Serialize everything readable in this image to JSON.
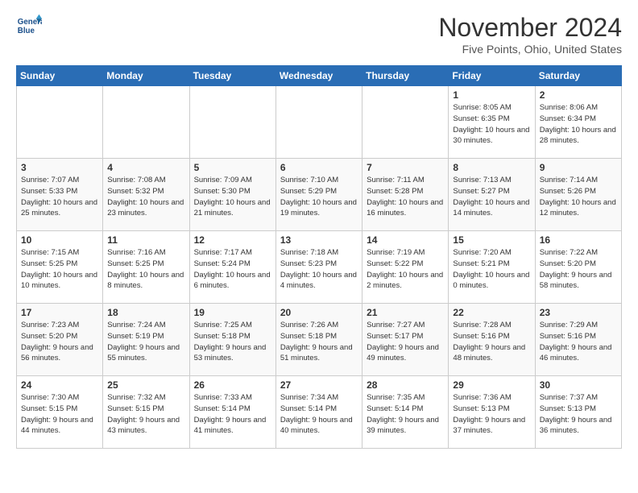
{
  "header": {
    "logo_line1": "General",
    "logo_line2": "Blue",
    "month_title": "November 2024",
    "location": "Five Points, Ohio, United States"
  },
  "weekdays": [
    "Sunday",
    "Monday",
    "Tuesday",
    "Wednesday",
    "Thursday",
    "Friday",
    "Saturday"
  ],
  "weeks": [
    [
      {
        "day": "",
        "info": ""
      },
      {
        "day": "",
        "info": ""
      },
      {
        "day": "",
        "info": ""
      },
      {
        "day": "",
        "info": ""
      },
      {
        "day": "",
        "info": ""
      },
      {
        "day": "1",
        "info": "Sunrise: 8:05 AM\nSunset: 6:35 PM\nDaylight: 10 hours\nand 30 minutes."
      },
      {
        "day": "2",
        "info": "Sunrise: 8:06 AM\nSunset: 6:34 PM\nDaylight: 10 hours\nand 28 minutes."
      }
    ],
    [
      {
        "day": "3",
        "info": "Sunrise: 7:07 AM\nSunset: 5:33 PM\nDaylight: 10 hours\nand 25 minutes."
      },
      {
        "day": "4",
        "info": "Sunrise: 7:08 AM\nSunset: 5:32 PM\nDaylight: 10 hours\nand 23 minutes."
      },
      {
        "day": "5",
        "info": "Sunrise: 7:09 AM\nSunset: 5:30 PM\nDaylight: 10 hours\nand 21 minutes."
      },
      {
        "day": "6",
        "info": "Sunrise: 7:10 AM\nSunset: 5:29 PM\nDaylight: 10 hours\nand 19 minutes."
      },
      {
        "day": "7",
        "info": "Sunrise: 7:11 AM\nSunset: 5:28 PM\nDaylight: 10 hours\nand 16 minutes."
      },
      {
        "day": "8",
        "info": "Sunrise: 7:13 AM\nSunset: 5:27 PM\nDaylight: 10 hours\nand 14 minutes."
      },
      {
        "day": "9",
        "info": "Sunrise: 7:14 AM\nSunset: 5:26 PM\nDaylight: 10 hours\nand 12 minutes."
      }
    ],
    [
      {
        "day": "10",
        "info": "Sunrise: 7:15 AM\nSunset: 5:25 PM\nDaylight: 10 hours\nand 10 minutes."
      },
      {
        "day": "11",
        "info": "Sunrise: 7:16 AM\nSunset: 5:25 PM\nDaylight: 10 hours\nand 8 minutes."
      },
      {
        "day": "12",
        "info": "Sunrise: 7:17 AM\nSunset: 5:24 PM\nDaylight: 10 hours\nand 6 minutes."
      },
      {
        "day": "13",
        "info": "Sunrise: 7:18 AM\nSunset: 5:23 PM\nDaylight: 10 hours\nand 4 minutes."
      },
      {
        "day": "14",
        "info": "Sunrise: 7:19 AM\nSunset: 5:22 PM\nDaylight: 10 hours\nand 2 minutes."
      },
      {
        "day": "15",
        "info": "Sunrise: 7:20 AM\nSunset: 5:21 PM\nDaylight: 10 hours\nand 0 minutes."
      },
      {
        "day": "16",
        "info": "Sunrise: 7:22 AM\nSunset: 5:20 PM\nDaylight: 9 hours\nand 58 minutes."
      }
    ],
    [
      {
        "day": "17",
        "info": "Sunrise: 7:23 AM\nSunset: 5:20 PM\nDaylight: 9 hours\nand 56 minutes."
      },
      {
        "day": "18",
        "info": "Sunrise: 7:24 AM\nSunset: 5:19 PM\nDaylight: 9 hours\nand 55 minutes."
      },
      {
        "day": "19",
        "info": "Sunrise: 7:25 AM\nSunset: 5:18 PM\nDaylight: 9 hours\nand 53 minutes."
      },
      {
        "day": "20",
        "info": "Sunrise: 7:26 AM\nSunset: 5:18 PM\nDaylight: 9 hours\nand 51 minutes."
      },
      {
        "day": "21",
        "info": "Sunrise: 7:27 AM\nSunset: 5:17 PM\nDaylight: 9 hours\nand 49 minutes."
      },
      {
        "day": "22",
        "info": "Sunrise: 7:28 AM\nSunset: 5:16 PM\nDaylight: 9 hours\nand 48 minutes."
      },
      {
        "day": "23",
        "info": "Sunrise: 7:29 AM\nSunset: 5:16 PM\nDaylight: 9 hours\nand 46 minutes."
      }
    ],
    [
      {
        "day": "24",
        "info": "Sunrise: 7:30 AM\nSunset: 5:15 PM\nDaylight: 9 hours\nand 44 minutes."
      },
      {
        "day": "25",
        "info": "Sunrise: 7:32 AM\nSunset: 5:15 PM\nDaylight: 9 hours\nand 43 minutes."
      },
      {
        "day": "26",
        "info": "Sunrise: 7:33 AM\nSunset: 5:14 PM\nDaylight: 9 hours\nand 41 minutes."
      },
      {
        "day": "27",
        "info": "Sunrise: 7:34 AM\nSunset: 5:14 PM\nDaylight: 9 hours\nand 40 minutes."
      },
      {
        "day": "28",
        "info": "Sunrise: 7:35 AM\nSunset: 5:14 PM\nDaylight: 9 hours\nand 39 minutes."
      },
      {
        "day": "29",
        "info": "Sunrise: 7:36 AM\nSunset: 5:13 PM\nDaylight: 9 hours\nand 37 minutes."
      },
      {
        "day": "30",
        "info": "Sunrise: 7:37 AM\nSunset: 5:13 PM\nDaylight: 9 hours\nand 36 minutes."
      }
    ]
  ]
}
